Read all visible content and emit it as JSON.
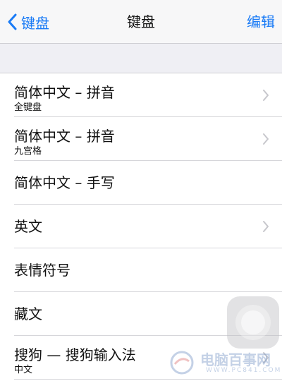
{
  "nav": {
    "back_label": "键盘",
    "title": "键盘",
    "edit_label": "编辑"
  },
  "keyboards": [
    {
      "title": "简体中文 – 拼音",
      "subtitle": "全键盘",
      "has_chevron": true
    },
    {
      "title": "简体中文 – 拼音",
      "subtitle": "九宫格",
      "has_chevron": true
    },
    {
      "title": "简体中文 – 手写",
      "subtitle": "",
      "has_chevron": false
    },
    {
      "title": "英文",
      "subtitle": "",
      "has_chevron": true
    },
    {
      "title": "表情符号",
      "subtitle": "",
      "has_chevron": false
    },
    {
      "title": "藏文",
      "subtitle": "",
      "has_chevron": false
    },
    {
      "title": "搜狗 — 搜狗输入法",
      "subtitle": "中文",
      "has_chevron": true
    }
  ],
  "watermark": {
    "text": "电脑百事网",
    "url": "WWW.PC841.COM"
  },
  "colors": {
    "accent": "#1a7bf6",
    "chevron": "#c7c7cc",
    "separator": "#d6d6da",
    "grouped_background": "#efeff4"
  },
  "icons": {
    "back": "chevron-left-icon",
    "disclosure": "chevron-right-icon",
    "assistive_touch": "assistive-touch-icon"
  }
}
